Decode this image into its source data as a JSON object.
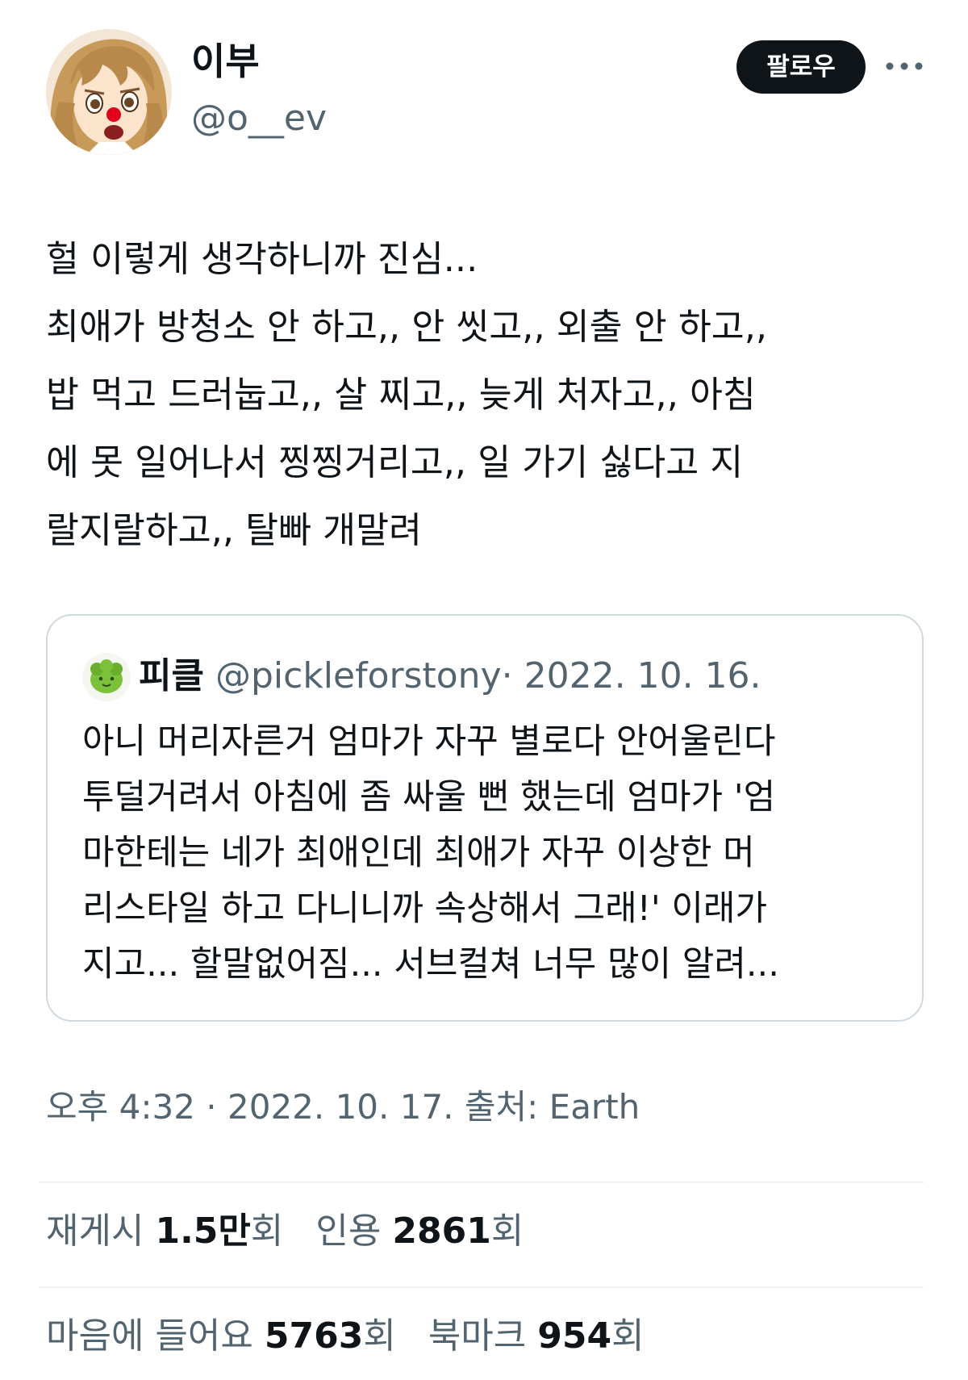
{
  "author": {
    "display_name": "이부",
    "handle": "@o__ev",
    "avatar_icon": "anime-girl-avatar"
  },
  "actions": {
    "follow_label": "팔로우",
    "more_icon": "more-horizontal-icon"
  },
  "tweet": {
    "lines": [
      "헐 이렇게 생각하니까 진심...",
      "최애가 방청소 안 하고,, 안 씻고,, 외출 안 하고,,",
      "밥 먹고 드러눕고,, 살 찌고,, 늦게 처자고,, 아침",
      "에 못 일어나서 찡찡거리고,, 일 가기 싫다고 지",
      "랄지랄하고,, 탈빠 개말려"
    ]
  },
  "quote": {
    "avatar_icon": "green-pickle-avatar",
    "name": "피클",
    "handle": "@pickleforstony",
    "separator": "·",
    "date": "2022. 10. 16.",
    "lines": [
      "아니 머리자른거 엄마가 자꾸 별로다 안어울린다",
      "투덜거려서 아침에 좀 싸울 뻔 했는데 엄마가 '엄",
      "마한테는 네가 최애인데 최애가 자꾸 이상한 머",
      "리스타일 하고 다니니까 속상해서 그래!' 이래가",
      "지고... 할말없어짐... 서브컬쳐 너무 많이 알려..."
    ]
  },
  "meta": {
    "timestamp": "오후 4:32 · 2022. 10. 17. 출처: Earth"
  },
  "stats": {
    "retweets": {
      "label": "재게시",
      "value": "1.5만",
      "unit": "회"
    },
    "quotes": {
      "label": "인용",
      "value": "2861",
      "unit": "회"
    },
    "likes": {
      "label": "마음에 들어요",
      "value": "5763",
      "unit": "회"
    },
    "bookmarks": {
      "label": "북마크",
      "value": "954",
      "unit": "회"
    }
  },
  "colors": {
    "text_primary": "#0f1419",
    "text_secondary": "#536471",
    "border": "#cfd9de",
    "divider": "#eff3f4",
    "follow_button_bg": "#0f1419"
  }
}
